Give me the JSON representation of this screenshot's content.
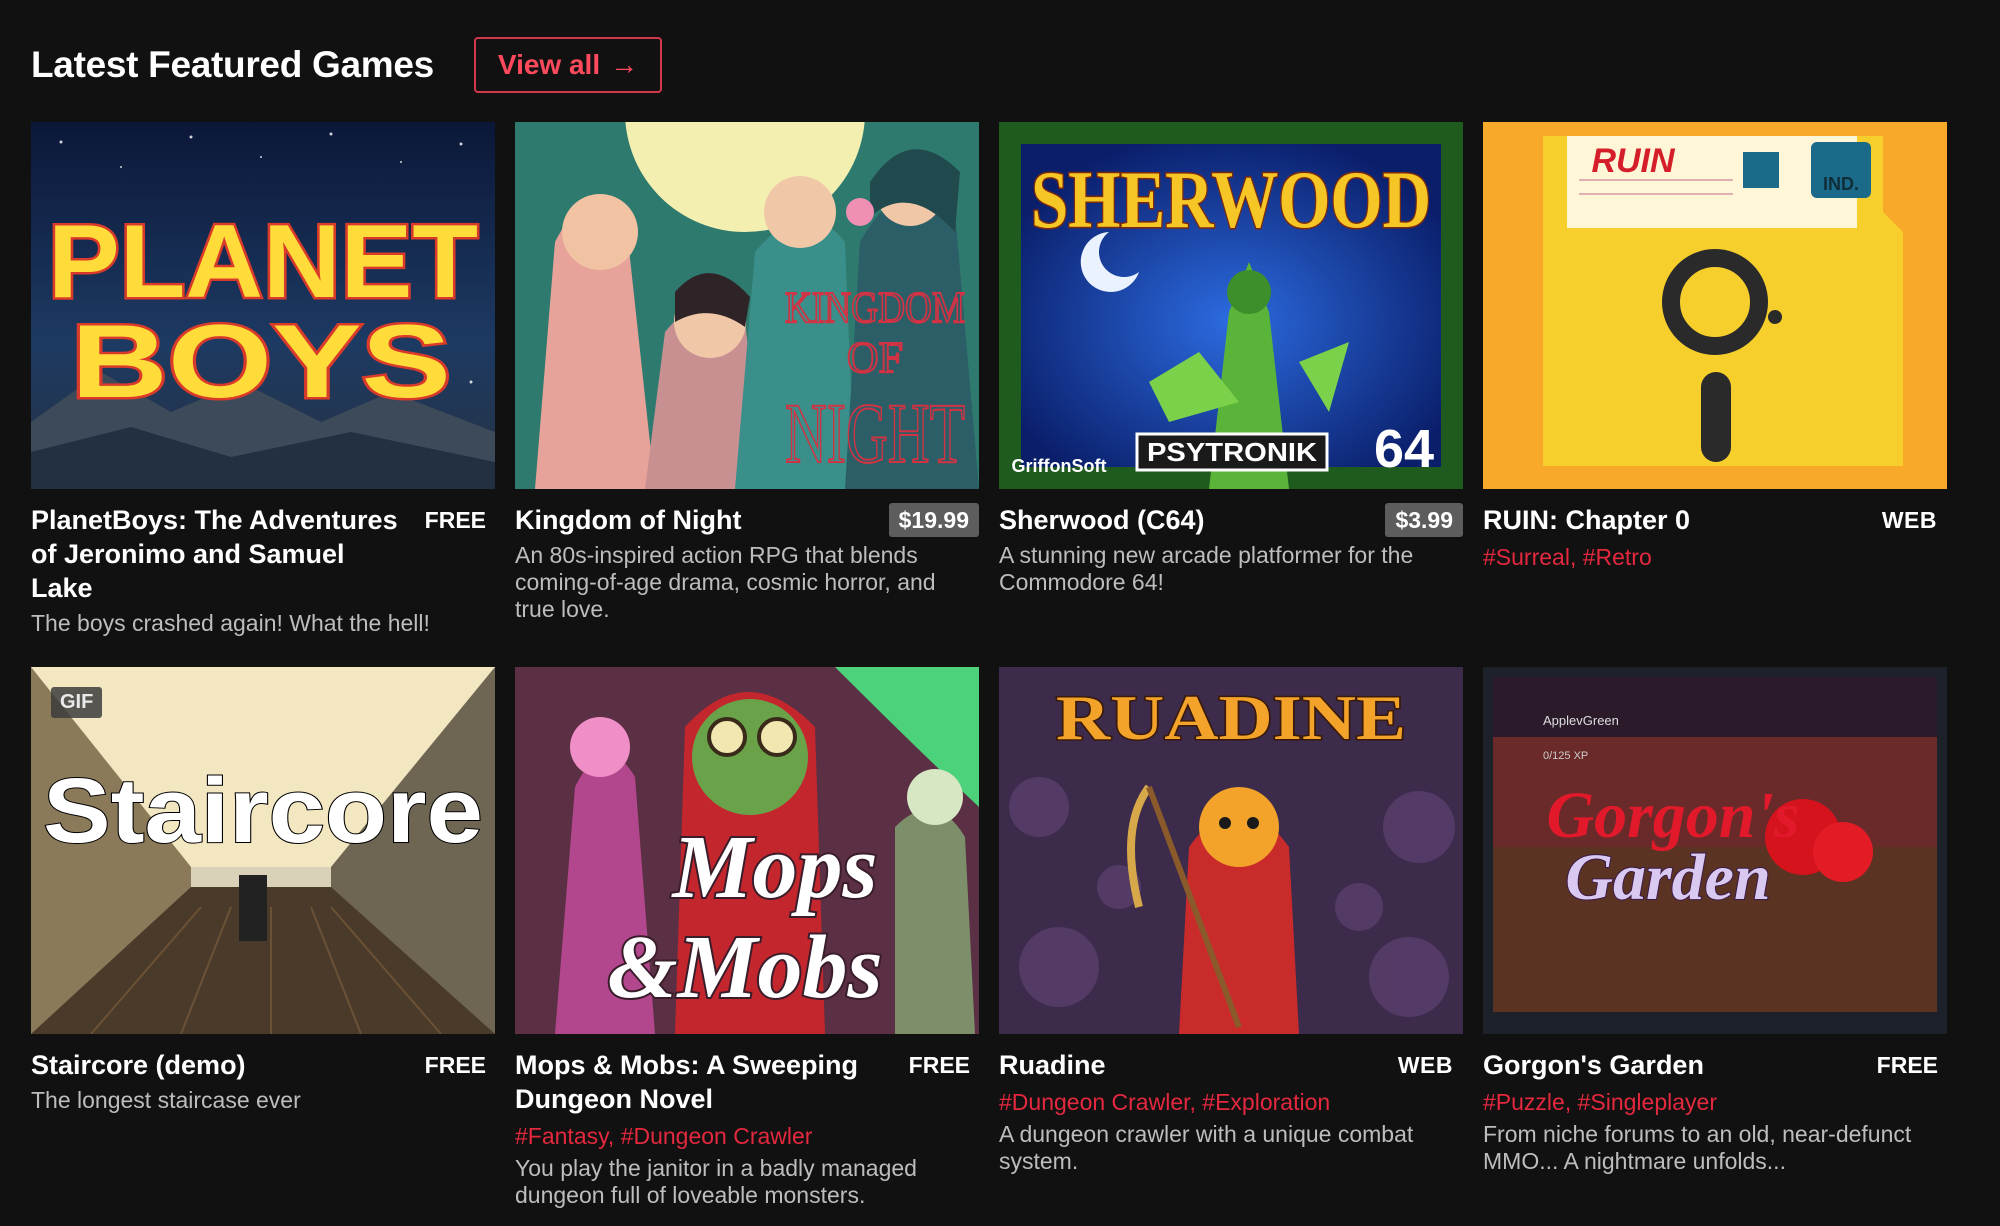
{
  "section": {
    "title": "Latest Featured Games",
    "view_all_label": "View all",
    "view_all_arrow": "→",
    "accent_color": "#e4283e"
  },
  "games": [
    {
      "title": "PlanetBoys: The Adventures of Jeronimo and Samuel Lake",
      "price": "FREE",
      "tags": [],
      "description": "The boys crashed again! What the hell!",
      "cover_text": [
        "PLANET",
        "BOYS"
      ]
    },
    {
      "title": "Kingdom of Night",
      "price": "$19.99",
      "tags": [],
      "description": "An 80s-inspired action RPG that blends coming-of-age drama, cosmic horror, and true love.",
      "cover_text": [
        "KINGDOM",
        "OF",
        "NIGHT"
      ]
    },
    {
      "title": "Sherwood (C64)",
      "price": "$3.99",
      "tags": [],
      "description": "A stunning new arcade platformer for the Commodore 64!",
      "cover_text": [
        "SHERWOOD",
        "GriffonSoft",
        "PSYTRONIK",
        "64"
      ]
    },
    {
      "title": "RUIN: Chapter 0",
      "platform": "WEB",
      "tags": [
        "#Surreal",
        "#Retro"
      ],
      "description": "",
      "cover_text": [
        "RUIN",
        "IND."
      ]
    },
    {
      "title": "Staircore (demo)",
      "price": "FREE",
      "tags": [],
      "description": "The longest staircase ever",
      "gif_badge": "GIF",
      "cover_text": [
        "Staircore"
      ]
    },
    {
      "title": "Mops & Mobs: A Sweeping Dungeon Novel",
      "price": "FREE",
      "tags": [
        "#Fantasy",
        "#Dungeon Crawler"
      ],
      "description": "You play the janitor in a badly managed dungeon full of loveable monsters.",
      "cover_text": [
        "Mops",
        "&Mobs"
      ]
    },
    {
      "title": "Ruadine",
      "platform": "WEB",
      "tags": [
        "#Dungeon Crawler",
        "#Exploration"
      ],
      "description": "A dungeon crawler with a unique combat system.",
      "cover_text": [
        "RUADINE"
      ]
    },
    {
      "title": "Gorgon's Garden",
      "price": "FREE",
      "tags": [
        "#Puzzle",
        "#Singleplayer"
      ],
      "description": "From niche forums to an old, near-defunct MMO... A nightmare unfolds...",
      "cover_text": [
        "Gorgon's",
        "Garden",
        "ApplevGreen",
        "0/125 XP"
      ]
    }
  ]
}
